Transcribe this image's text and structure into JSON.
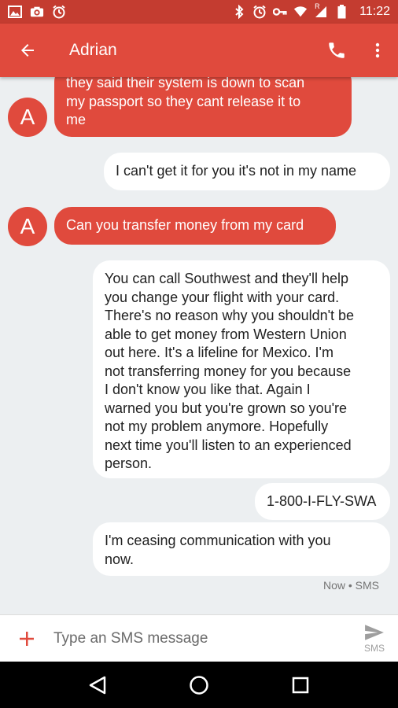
{
  "status_bar": {
    "time": "11:22",
    "left_icons": [
      "image-icon",
      "camera-icon",
      "alarm-icon"
    ],
    "right_icons": [
      "bluetooth-icon",
      "alarm-icon",
      "vpn-key-icon",
      "wifi-icon",
      "signal-icon",
      "battery-icon"
    ],
    "signal_label": "R"
  },
  "app_bar": {
    "contact_name": "Adrian",
    "back_icon": "arrow-back-icon",
    "call_icon": "phone-icon",
    "more_icon": "more-vert-icon"
  },
  "messages": [
    {
      "direction": "in",
      "avatar": "A",
      "lines": [
        "they said their system is down to scan",
        "my passport so they cant release it to",
        "me"
      ]
    },
    {
      "direction": "out",
      "lines": [
        "I can't get it for you it's not in my name"
      ]
    },
    {
      "direction": "in",
      "avatar": "A",
      "lines": [
        "Can you transfer money from my card"
      ]
    },
    {
      "direction": "out",
      "lines": [
        "You can call Southwest and they'll help",
        "you change your flight with your card.",
        "There's no reason why you shouldn't be",
        "able to get money from Western Union",
        "out here. It's a lifeline for Mexico. I'm",
        "not transferring money for you because",
        "I don't know you like that. Again I",
        "warned you but you're grown so you're",
        "not my problem anymore. Hopefully",
        "next time you'll listen to an experienced",
        "person."
      ]
    },
    {
      "direction": "out",
      "lines": [
        "1-800-I-FLY-SWA"
      ]
    },
    {
      "direction": "out",
      "lines": [
        "I'm ceasing communication with you",
        "now."
      ]
    }
  ],
  "last_meta": "Now • SMS",
  "compose": {
    "placeholder": "Type an SMS message",
    "send_label": "SMS"
  },
  "colors": {
    "accent": "#e04a3d",
    "status_bar": "#c43c30",
    "background": "#eceff1",
    "outgoing_bubble": "#ffffff"
  }
}
